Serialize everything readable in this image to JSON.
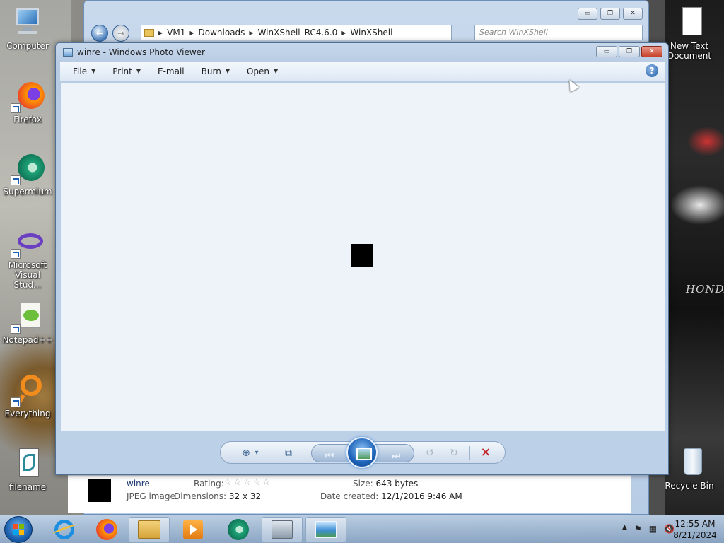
{
  "desktop": {
    "icons_left": [
      {
        "label": "Computer",
        "icon": "computer-icon"
      },
      {
        "label": "Firefox",
        "icon": "firefox-icon"
      },
      {
        "label": "Supermium",
        "icon": "supermium-icon"
      },
      {
        "label": "Microsoft Visual Stud...",
        "icon": "visual-studio-icon"
      },
      {
        "label": "Notepad++",
        "icon": "notepad-plus-plus-icon"
      },
      {
        "label": "Everything",
        "icon": "everything-icon"
      },
      {
        "label": "filename",
        "icon": "script-file-icon"
      }
    ],
    "icons_right": [
      {
        "label": "New Text Document",
        "icon": "text-document-icon"
      },
      {
        "label": "Recycle Bin",
        "icon": "recycle-bin-icon"
      }
    ],
    "wallpaper_text": "HONDA"
  },
  "explorer": {
    "breadcrumb": [
      "VM1",
      "Downloads",
      "WinXShell_RC4.6.0",
      "WinXShell"
    ],
    "search_placeholder": "Search WinXShell",
    "details": {
      "name": "winre",
      "type": "JPEG image",
      "rating_label": "Rating:",
      "stars": "☆☆☆☆☆",
      "dimensions_label": "Dimensions:",
      "dimensions": "32 x 32",
      "size_label": "Size:",
      "size": "643 bytes",
      "date_label": "Date created:",
      "date": "12/1/2016 9:46 AM"
    }
  },
  "viewer": {
    "title": "winre - Windows Photo Viewer",
    "menu": [
      {
        "label": "File",
        "has_dropdown": true
      },
      {
        "label": "Print",
        "has_dropdown": true
      },
      {
        "label": "E-mail",
        "has_dropdown": false
      },
      {
        "label": "Burn",
        "has_dropdown": true
      },
      {
        "label": "Open",
        "has_dropdown": true
      }
    ],
    "help_glyph": "?",
    "controls": {
      "minimize": "▭",
      "maximize": "❐",
      "close": "✕"
    },
    "toolbar": {
      "zoom_glyph": "⊕",
      "zoom_caret": "▾",
      "actual_size_glyph": "⧉",
      "prev_glyph": "⏮",
      "next_glyph": "⏭",
      "rotate_ccw_glyph": "↺",
      "rotate_cw_glyph": "↻",
      "delete_glyph": "✕"
    }
  },
  "taskbar": {
    "apps": [
      "ie-icon",
      "firefox-icon",
      "explorer-icon",
      "media-player-icon",
      "supermium-icon",
      "tools-icon",
      "photo-viewer-icon"
    ],
    "tray": {
      "show_hidden": "▲",
      "flag": "⚑",
      "network": "▦",
      "volume": "🔇"
    },
    "time": "12:55 AM",
    "date": "8/21/2024"
  }
}
